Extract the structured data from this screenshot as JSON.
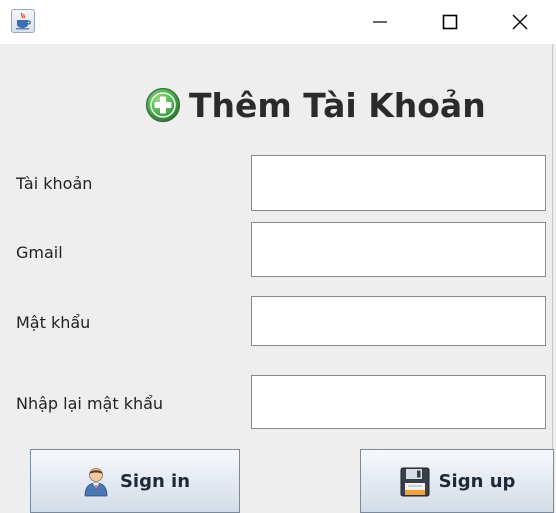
{
  "window": {
    "icon": "java-cup-icon",
    "controls": [
      "minimize-icon",
      "maximize-icon",
      "close-icon"
    ]
  },
  "form": {
    "title": "Thêm Tài Khoản",
    "title_icon": "plus-circle-icon",
    "fields": [
      {
        "label": "Tài khoản",
        "value": ""
      },
      {
        "label": "Gmail",
        "value": ""
      },
      {
        "label": "Mật khẩu",
        "value": ""
      },
      {
        "label": "Nhập lại mật khẩu",
        "value": ""
      }
    ]
  },
  "buttons": {
    "sign_in": {
      "label": "Sign in",
      "icon": "user-icon"
    },
    "sign_up": {
      "label": "Sign up",
      "icon": "floppy-disk-icon"
    }
  },
  "colors": {
    "title_text": "#2b2b2b",
    "accent_green": "#4caf50",
    "window_bg": "#eeeeee"
  }
}
